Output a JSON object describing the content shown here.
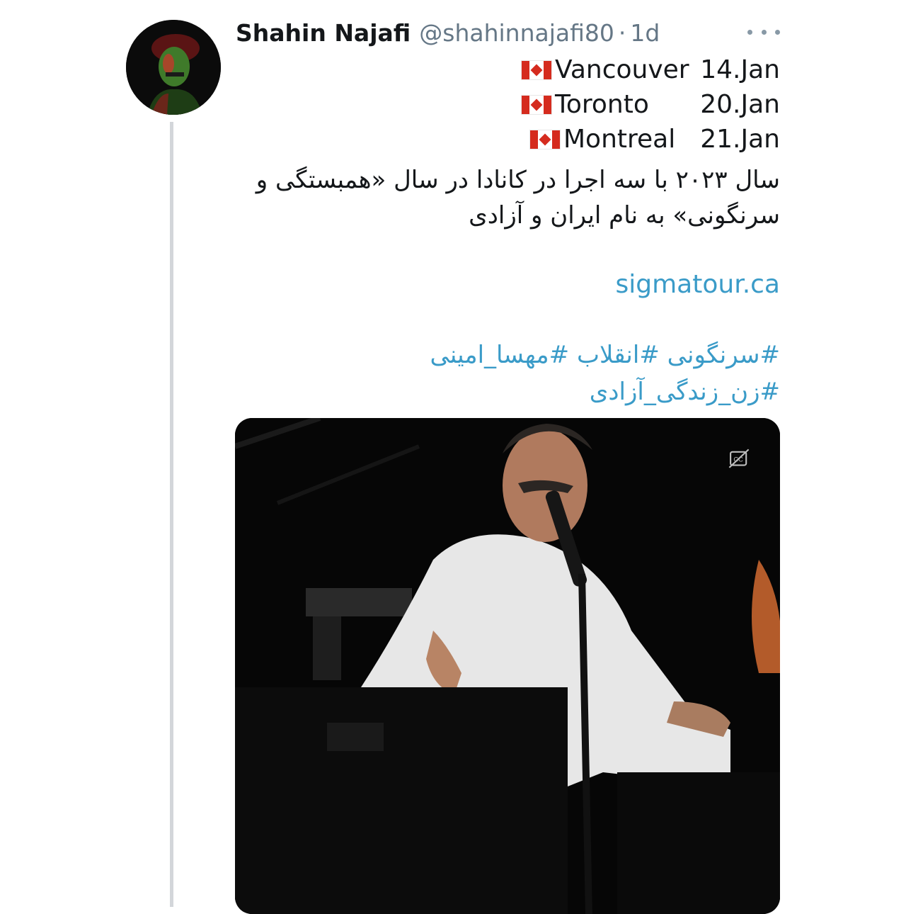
{
  "tweet": {
    "display_name": "Shahin Najafi",
    "handle": "@shahinnajafi80",
    "separator": "·",
    "time": "1d",
    "tour_dates": [
      {
        "city": "Vancouver",
        "date": "14.Jan"
      },
      {
        "city": "Toronto",
        "date": "20.Jan"
      },
      {
        "city": "Montreal",
        "date": "21.Jan"
      }
    ],
    "persian_text": "سال ۲۰۲۳ با سه اجرا در کانادا در سال «همبستگی و سرنگونی» به نام ایران و آزادی",
    "link": "sigmatour.ca",
    "hashtags": [
      "#سرنگونی",
      "#انقلاب",
      "#مهسا_امینی",
      "#زن_زندگی_آزادی"
    ]
  },
  "icons": {
    "more": "more-options-icon",
    "flag": "canada-flag-icon",
    "captions": "closed-captions-icon"
  },
  "colors": {
    "link": "#3a9bc8",
    "muted": "#657786",
    "thread_line": "#d3d6da"
  }
}
